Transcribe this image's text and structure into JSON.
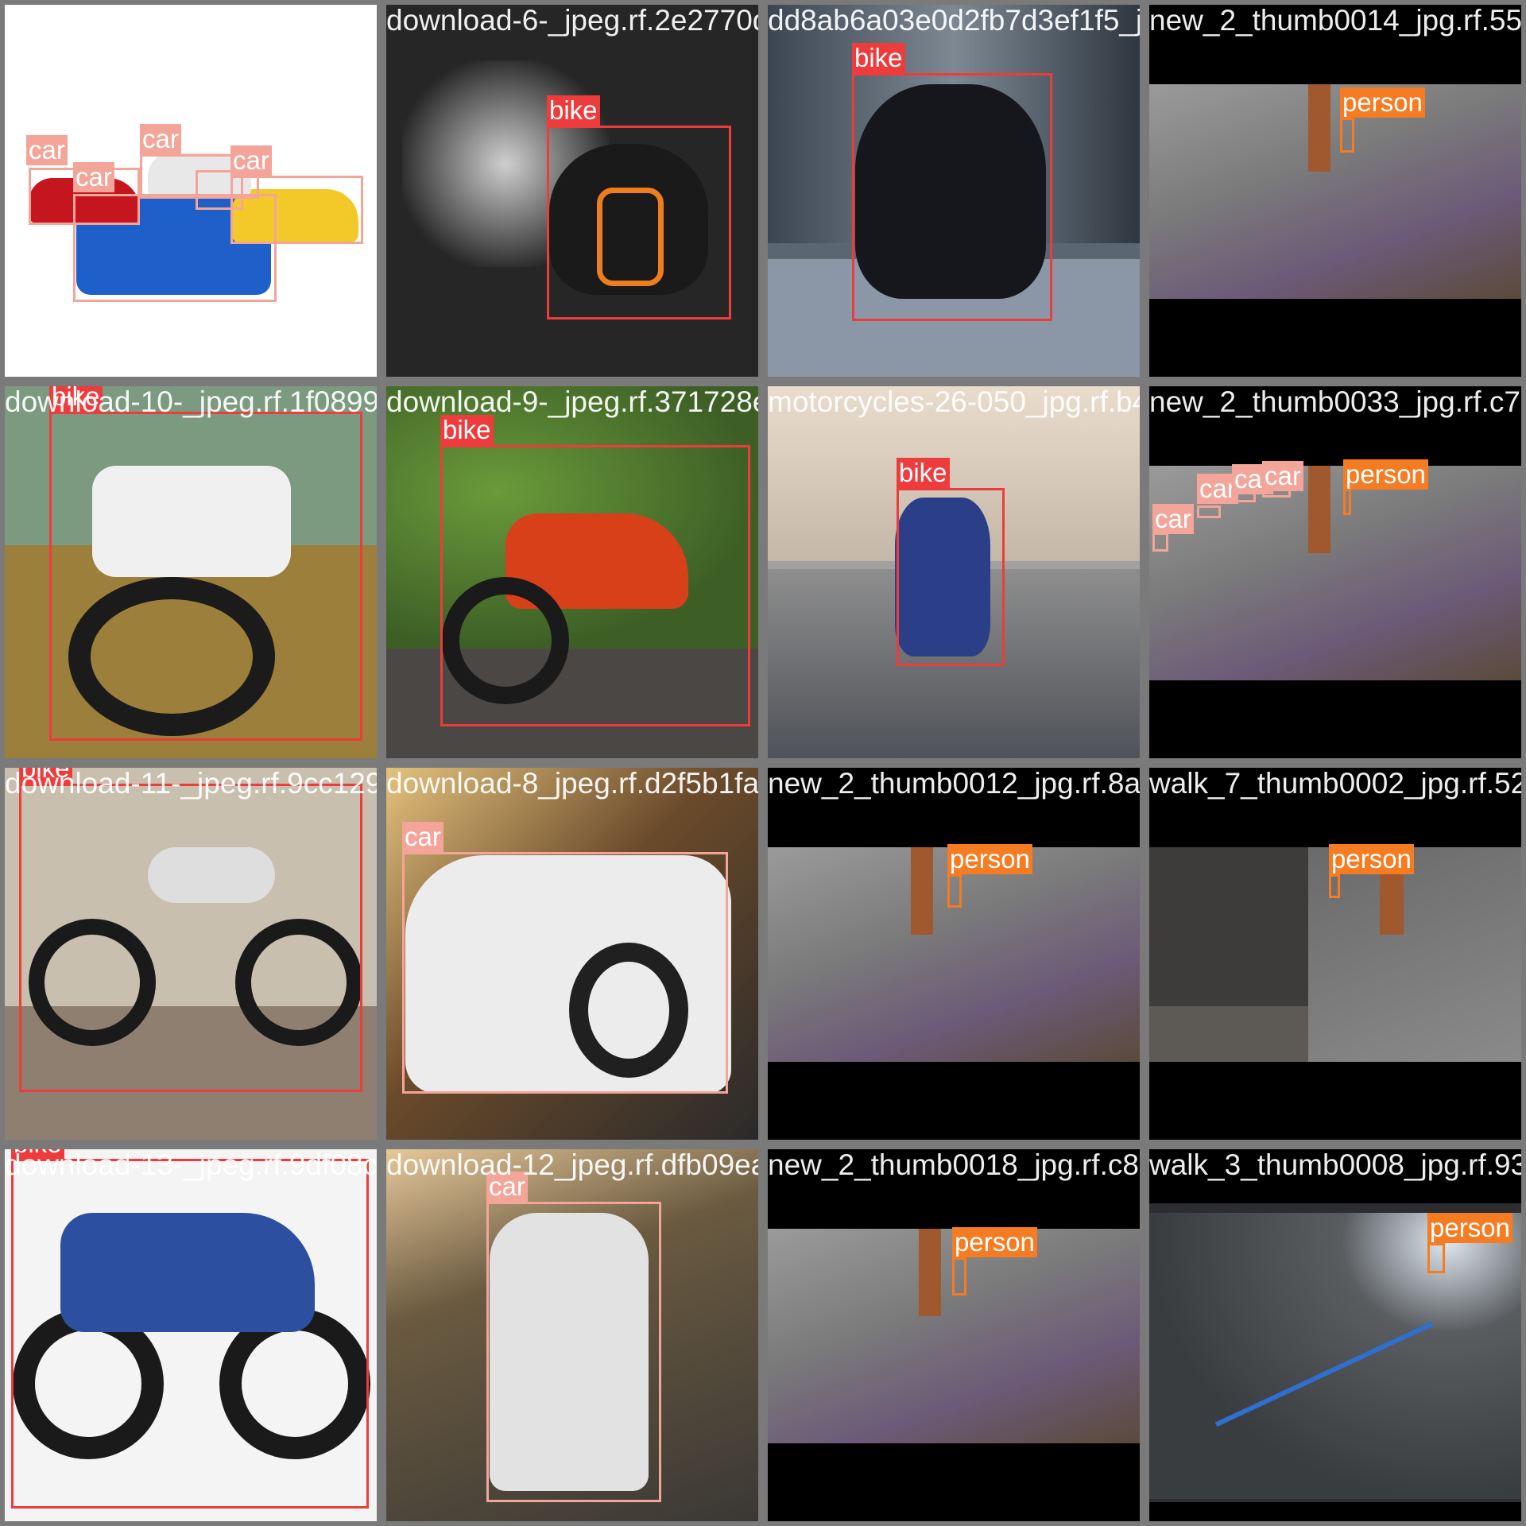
{
  "colors": {
    "bike": "#ee3b3b",
    "car": "#f4a59a",
    "person": "#f57c22",
    "tile_border": "#7a7a7a"
  },
  "tiles": [
    {
      "filename": "depositphotos_63023511-stock-photo-cars.jpg",
      "bg": "#ffffff",
      "letterbox": "none",
      "detections": [
        {
          "class": "car"
        },
        {
          "class": "car"
        },
        {
          "class": "car"
        },
        {
          "class": "car"
        },
        {
          "class": "car"
        }
      ]
    },
    {
      "filename": "download-6-_jpeg.rf.2e2770d87f9756bc930bee211f21f5393",
      "bg": "#262626",
      "letterbox": "none",
      "detections": [
        {
          "class": "bike"
        }
      ]
    },
    {
      "filename": "dd8ab6a03e0d2fb7d3ef1f5_jpg.rf.c2e4",
      "bg": "#5a6773",
      "letterbox": "none",
      "detections": [
        {
          "class": "bike"
        }
      ]
    },
    {
      "filename": "new_2_thumb0014_jpg.rf.55",
      "bg": "#6d6a66",
      "letterbox": "top-bottom",
      "detections": [
        {
          "class": "person"
        }
      ]
    },
    {
      "filename": "download-10-_jpeg.rf.1f0899a7b23a6e1e44af4",
      "bg": "#8c7a46",
      "letterbox": "none",
      "detections": [
        {
          "class": "bike"
        }
      ]
    },
    {
      "filename": "download-9-_jpeg.rf.371728e94f5dbe1e4f2f",
      "bg": "#4d6a35",
      "letterbox": "none",
      "detections": [
        {
          "class": "bike"
        }
      ]
    },
    {
      "filename": "motorcycles-26-050_jpg.rf.b49207bd6bbe",
      "bg": "#a3a0a0",
      "letterbox": "none",
      "detections": [
        {
          "class": "bike"
        }
      ]
    },
    {
      "filename": "new_2_thumb0033_jpg.rf.c7",
      "bg": "#6d6a66",
      "letterbox": "top-bottom",
      "detections": [
        {
          "class": "car"
        },
        {
          "class": "car"
        },
        {
          "class": "car"
        },
        {
          "class": "car"
        },
        {
          "class": "person"
        }
      ]
    },
    {
      "filename": "download-11-_jpeg.rf.9cc1295c4fad98a1c1415fadbee",
      "bg": "#8a7a6c",
      "letterbox": "none",
      "detections": [
        {
          "class": "bike"
        }
      ]
    },
    {
      "filename": "download-8_jpeg.rf.d2f5b1fadbee2ef8",
      "bg": "#7a5a30",
      "letterbox": "none",
      "detections": [
        {
          "class": "car"
        }
      ]
    },
    {
      "filename": "new_2_thumb0012_jpg.rf.8a",
      "bg": "#6d6a66",
      "letterbox": "top-bottom",
      "detections": [
        {
          "class": "person"
        }
      ]
    },
    {
      "filename": "walk_7_thumb0002_jpg.rf.52",
      "bg": "#5d5a55",
      "letterbox": "top-bottom",
      "detections": [
        {
          "class": "person"
        }
      ]
    },
    {
      "filename": "download-13-_jpeg.rf.9df08c",
      "bg": "#f4f4f4",
      "letterbox": "none",
      "detections": [
        {
          "class": "bike"
        }
      ]
    },
    {
      "filename": "download-12_jpeg.rf.dfb09ea5",
      "bg": "#5a5040",
      "letterbox": "none",
      "detections": [
        {
          "class": "car"
        }
      ]
    },
    {
      "filename": "new_2_thumb0018_jpg.rf.c8",
      "bg": "#6d6a66",
      "letterbox": "top-bottom",
      "detections": [
        {
          "class": "person"
        }
      ]
    },
    {
      "filename": "walk_3_thumb0008_jpg.rf.93",
      "bg": "#2b2d30",
      "letterbox": "none",
      "detections": [
        {
          "class": "person"
        }
      ]
    }
  ]
}
